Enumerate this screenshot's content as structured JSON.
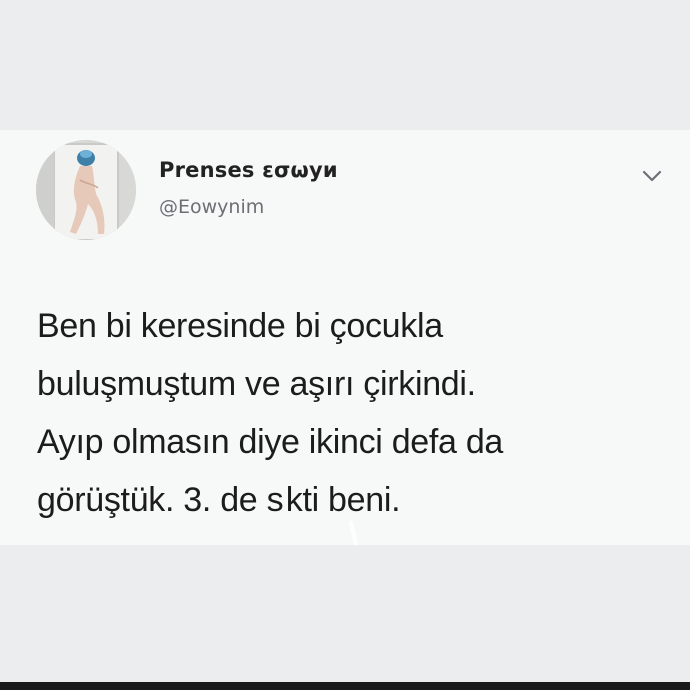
{
  "tweet": {
    "author": {
      "display_name": "Prenses εσωyи",
      "handle": "@Eowynim"
    },
    "text": "Ben bi keresinde bi çocukla\nbuluşmuştum ve aşırı çirkindi.\nAyıp olmasın diye ikinci defa da\ngörüştük. 3. de s kti beni.",
    "menu_icon": "chevron-down-icon"
  },
  "colors": {
    "background": "#ecedee",
    "card": "#f7f8f8",
    "name_text": "#222222",
    "handle_text": "#6b7075",
    "body_text": "#1c1c1c",
    "bottom_bar": "#1a1a1a"
  }
}
